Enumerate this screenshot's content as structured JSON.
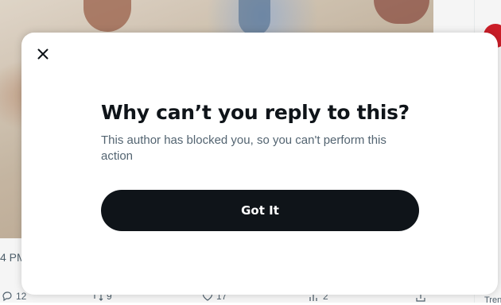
{
  "background": {
    "tweet_time_fragment": "4 PM",
    "actions": {
      "replies": "12",
      "reposts": "9",
      "likes": "17",
      "bookmarks": "2"
    },
    "sidebar_fragment": "Tren"
  },
  "modal": {
    "close_icon": "close-icon",
    "title": "Why can’t you reply to this?",
    "description": "This author has blocked you, so you can't perform this action",
    "got_it_label": "Got It"
  },
  "colors": {
    "text_primary": "#0f1419",
    "text_secondary": "#536471",
    "button_bg": "#0f1419",
    "button_text": "#ffffff"
  }
}
